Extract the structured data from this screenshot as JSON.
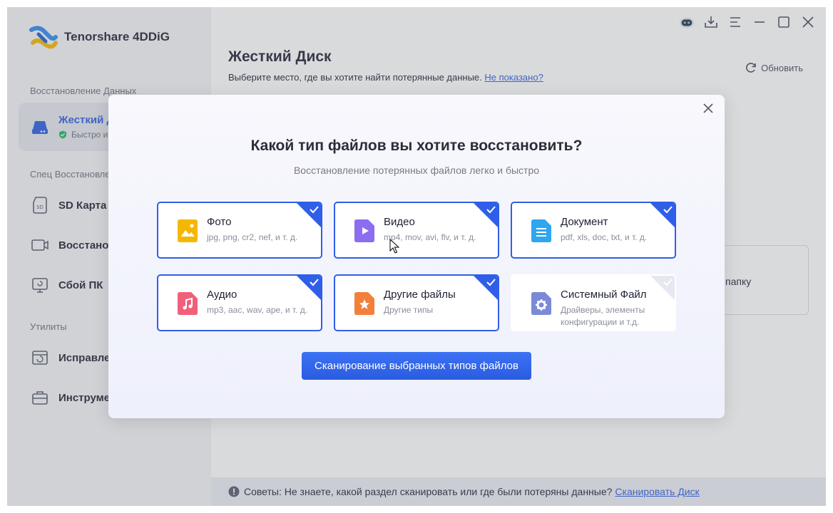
{
  "app": {
    "name": "Tenorshare 4DDiG"
  },
  "sidebar": {
    "section_recovery": "Восстановление Данных",
    "section_special": "Спец Восстановле",
    "section_utilities": "Утилиты",
    "items": [
      {
        "label": "Жесткий Д",
        "sub": "Быстро и",
        "icon": "hard-drive-icon"
      },
      {
        "label": "SD Карта",
        "icon": "sd-card-icon"
      },
      {
        "label": "Восстанов",
        "icon": "video-camera-icon"
      },
      {
        "label": "Сбой ПК",
        "icon": "pc-crash-icon"
      },
      {
        "label": "Исправле",
        "icon": "repair-icon"
      },
      {
        "label": "Инструме",
        "icon": "toolbox-icon"
      }
    ]
  },
  "main": {
    "title": "Жесткий Диск",
    "subtitle": "Выберите место, где вы хотите найти потерянные данные.",
    "subtitle_link": "Не показано?",
    "refresh_label": "Обновить",
    "folder_card_label": "папку",
    "tip_text": "Советы: Не знаете, какой раздел сканировать или где были потеряны данные?",
    "tip_link": "Сканировать Диск"
  },
  "modal": {
    "title": "Какой тип файлов вы хотите восстановить?",
    "subtitle": "Восстановление потерянных файлов легко и быстро",
    "scan_button": "Сканирование выбранных типов файлов",
    "file_types": [
      {
        "title": "Фото",
        "sub": "jpg, png, cr2, nef, и т. д.",
        "checked": true,
        "icon": "photo-icon",
        "color": "#f5b800"
      },
      {
        "title": "Видео",
        "sub": "mp4, mov, avi, flv, и т. д.",
        "checked": true,
        "icon": "video-icon",
        "color": "#8c6df0"
      },
      {
        "title": "Документ",
        "sub": "pdf, xls, doc, txt, и т. д.",
        "checked": true,
        "icon": "document-icon",
        "color": "#2fa6f0"
      },
      {
        "title": "Аудио",
        "sub": "mp3, aac, wav, ape, и т. д.",
        "checked": true,
        "icon": "audio-icon",
        "color": "#f0607a"
      },
      {
        "title": "Другие файлы",
        "sub": "Другие типы",
        "checked": true,
        "icon": "other-files-icon",
        "color": "#f2803a"
      },
      {
        "title": "Системный Файл",
        "sub": "Драйверы, элементы конфигурации и т.д.",
        "checked": false,
        "icon": "system-file-icon",
        "color": "#7a8ad8"
      }
    ]
  },
  "topbar": {
    "icons": [
      "assistant-bot-icon",
      "download-icon",
      "menu-icon",
      "minimize-icon",
      "maximize-icon",
      "close-icon"
    ]
  }
}
